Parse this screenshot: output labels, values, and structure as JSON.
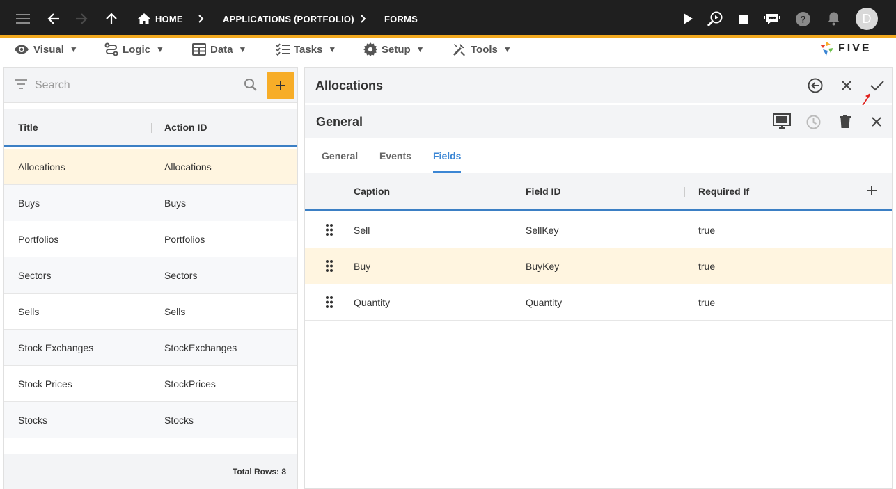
{
  "topbar": {
    "breadcrumbs": [
      "HOME",
      "APPLICATIONS (PORTFOLIO)",
      "FORMS"
    ],
    "avatar_letter": "D"
  },
  "menu": {
    "items": [
      {
        "label": "Visual",
        "icon": "eye-icon"
      },
      {
        "label": "Logic",
        "icon": "logic-icon"
      },
      {
        "label": "Data",
        "icon": "table-icon"
      },
      {
        "label": "Tasks",
        "icon": "checklist-icon"
      },
      {
        "label": "Setup",
        "icon": "gear-icon"
      },
      {
        "label": "Tools",
        "icon": "tools-icon"
      }
    ],
    "caret": "▼",
    "logo_text": "FIVE"
  },
  "left": {
    "search_placeholder": "Search",
    "columns": [
      "Title",
      "Action ID"
    ],
    "rows": [
      {
        "title": "Allocations",
        "action_id": "Allocations"
      },
      {
        "title": "Buys",
        "action_id": "Buys"
      },
      {
        "title": "Portfolios",
        "action_id": "Portfolios"
      },
      {
        "title": "Sectors",
        "action_id": "Sectors"
      },
      {
        "title": "Sells",
        "action_id": "Sells"
      },
      {
        "title": "Stock Exchanges",
        "action_id": "StockExchanges"
      },
      {
        "title": "Stock Prices",
        "action_id": "StockPrices"
      },
      {
        "title": "Stocks",
        "action_id": "Stocks"
      }
    ],
    "footer": "Total Rows: 8"
  },
  "right": {
    "title": "Allocations",
    "sub_title": "General",
    "tabs": [
      "General",
      "Events",
      "Fields"
    ],
    "active_tab": "Fields",
    "columns": [
      "Caption",
      "Field ID",
      "Required If"
    ],
    "rows": [
      {
        "caption": "Sell",
        "field_id": "SellKey",
        "required_if": "true"
      },
      {
        "caption": "Buy",
        "field_id": "BuyKey",
        "required_if": "true"
      },
      {
        "caption": "Quantity",
        "field_id": "Quantity",
        "required_if": "true"
      }
    ]
  },
  "colors": {
    "accent": "#f7ad28",
    "topbar": "#1f1f1f",
    "tab_active": "#3b86d4",
    "selected_row": "#fff5e0"
  }
}
